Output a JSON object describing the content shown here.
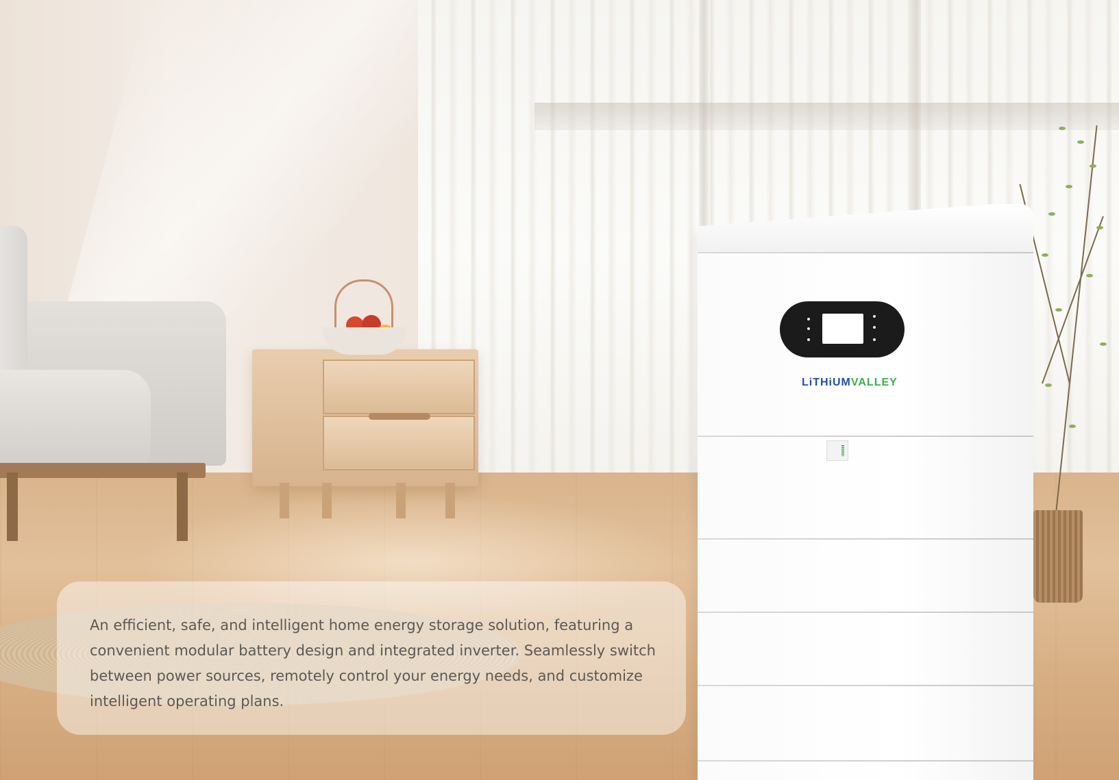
{
  "product": {
    "brand_part1": "LiTHiUM",
    "brand_part2": "VALLEY",
    "colors": {
      "brand_blue": "#1f4fa8",
      "brand_green": "#3cae4a",
      "panel_black": "#1b1b1b"
    }
  },
  "caption": {
    "text": "An efficient, safe, and intelligent home energy storage solution, featuring a convenient modular battery design and integrated inverter. Seamlessly switch between power sources, remotely control your energy needs, and customize intelligent operating plans."
  }
}
